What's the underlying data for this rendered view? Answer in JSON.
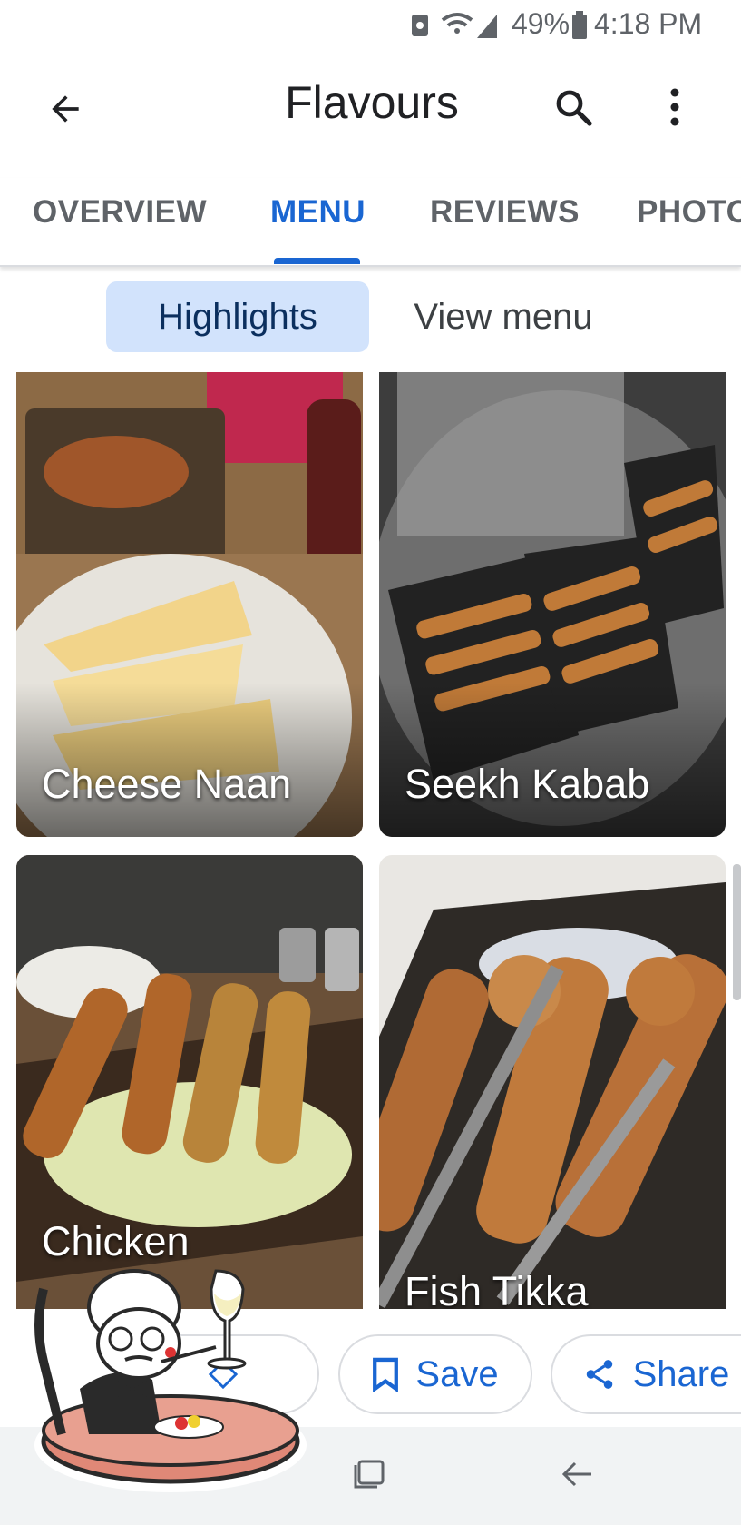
{
  "status_bar": {
    "battery": "49%",
    "time": "4:18 PM"
  },
  "app_bar": {
    "title": "Flavours",
    "back_icon": "arrow-back-icon",
    "search_icon": "search-icon",
    "more_icon": "more-vert-icon"
  },
  "tabs": [
    {
      "label": "OVERVIEW",
      "active": false
    },
    {
      "label": "MENU",
      "active": true
    },
    {
      "label": "REVIEWS",
      "active": false
    },
    {
      "label": "PHOTO",
      "active": false
    }
  ],
  "chips": {
    "highlights": "Highlights",
    "view_menu": "View menu"
  },
  "menu_items": [
    {
      "name": "Cheese Naan"
    },
    {
      "name": "Seekh Kabab"
    },
    {
      "name": "Chicken"
    },
    {
      "name": "Fish Tikka"
    }
  ],
  "actions": {
    "save": "Save",
    "share": "Share"
  },
  "colors": {
    "accent": "#1a66d2",
    "chip_bg": "#d2e3fc"
  }
}
